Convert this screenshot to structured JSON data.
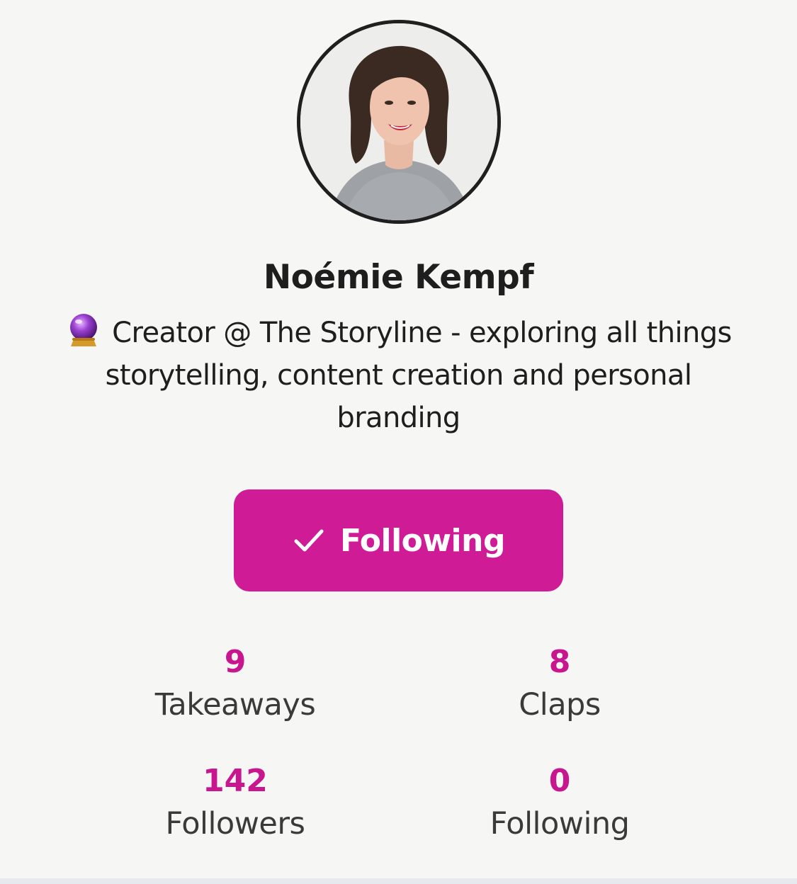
{
  "profile": {
    "name": "Noémie Kempf",
    "bio_icon": "crystal-ball-icon",
    "bio": "Creator @ The Storyline - exploring all things storytelling, content creation and personal branding"
  },
  "follow_button": {
    "label": "Following",
    "icon": "check-icon",
    "color": "#cf1b96"
  },
  "stats": {
    "takeaways": {
      "value": "9",
      "label": "Takeaways"
    },
    "claps": {
      "value": "8",
      "label": "Claps"
    },
    "followers": {
      "value": "142",
      "label": "Followers"
    },
    "following": {
      "value": "0",
      "label": "Following"
    }
  },
  "colors": {
    "accent": "#cf1b96",
    "stat_number": "#c8168f",
    "background": "#f6f6f4"
  }
}
